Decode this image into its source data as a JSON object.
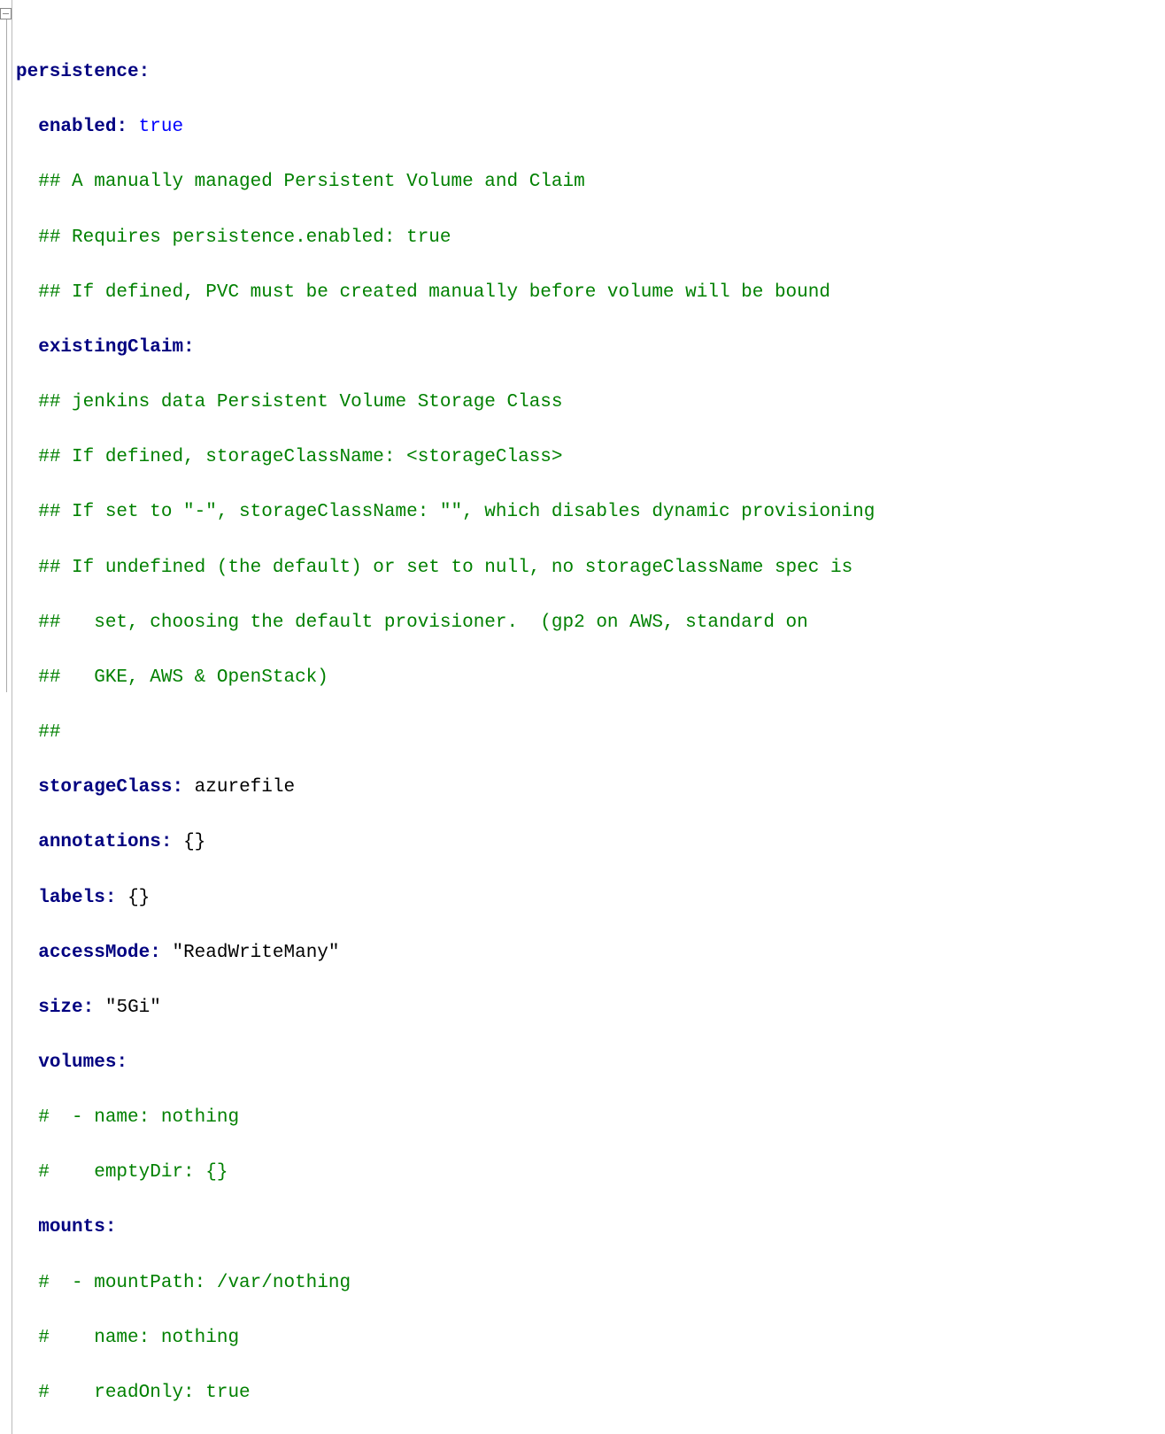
{
  "lines": {
    "l1_key": "persistence",
    "l2_key": "enabled",
    "l2_val": "true",
    "l3": "## A manually managed Persistent Volume and Claim",
    "l4": "## Requires persistence.enabled: true",
    "l5": "## If defined, PVC must be created manually before volume will be bound",
    "l6_key": "existingClaim",
    "l7": "## jenkins data Persistent Volume Storage Class",
    "l8": "## If defined, storageClassName: <storageClass>",
    "l9": "## If set to \"-\", storageClassName: \"\", which disables dynamic provisioning",
    "l10": "## If undefined (the default) or set to null, no storageClassName spec is",
    "l11": "##   set, choosing the default provisioner.  (gp2 on AWS, standard on",
    "l12": "##   GKE, AWS & OpenStack)",
    "l13": "##",
    "l14_key": "storageClass",
    "l14_val": "azurefile",
    "l15_key": "annotations",
    "l15_val": "{}",
    "l16_key": "labels",
    "l16_val": "{}",
    "l17_key": "accessMode",
    "l17_val": "\"ReadWriteMany\"",
    "l18_key": "size",
    "l18_val": "\"5Gi\"",
    "l19_key": "volumes",
    "l20": "#  - name: nothing",
    "l21": "#    emptyDir: {}",
    "l22_key": "mounts",
    "l23": "#  - mountPath: /var/nothing",
    "l24": "#    name: nothing",
    "l25": "#    readOnly: true"
  }
}
